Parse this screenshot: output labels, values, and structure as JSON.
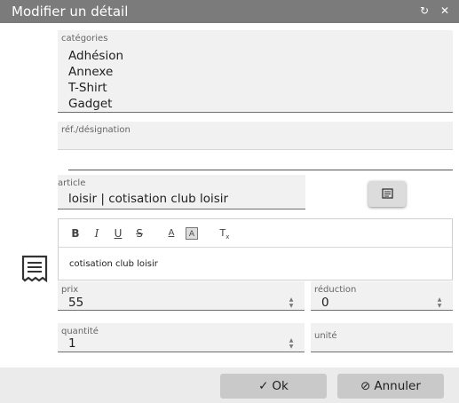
{
  "window": {
    "title": "Modifier un détail",
    "reload_icon": "↻",
    "close_icon": "✕"
  },
  "categories": {
    "label": "catégories",
    "options": [
      "Adhésion",
      "Annexe",
      "T-Shirt",
      "Gadget"
    ]
  },
  "reference": {
    "label": "réf./désignation",
    "value": ""
  },
  "article": {
    "label": "article",
    "value": "loisir | cotisation club loisir"
  },
  "editor": {
    "tools": {
      "bold": "B",
      "italic": "I",
      "underline": "U",
      "strike": "S",
      "font_color": "A",
      "highlight": "A",
      "clear": "T"
    },
    "content": "cotisation club loisir"
  },
  "prix": {
    "label": "prix",
    "value": "55"
  },
  "reduction": {
    "label": "réduction",
    "value": "0"
  },
  "quantite": {
    "label": "quantité",
    "value": "1"
  },
  "unite": {
    "label": "unité",
    "value": ""
  },
  "footer": {
    "ok_icon": "✓",
    "ok_label": "Ok",
    "cancel_icon": "⊘",
    "cancel_label": "Annuler"
  }
}
